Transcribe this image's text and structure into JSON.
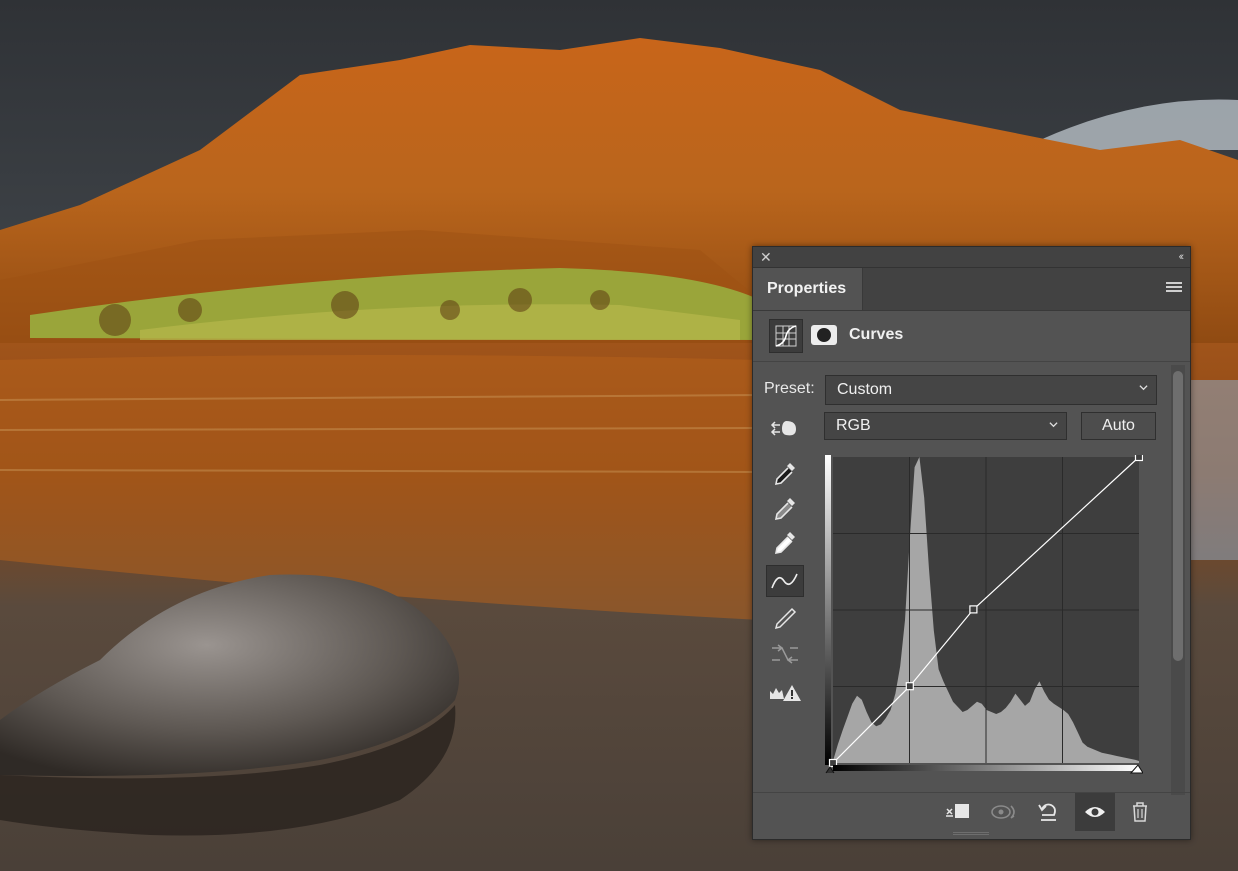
{
  "panel": {
    "tab_label": "Properties",
    "adjustment_title": "Curves",
    "preset": {
      "label": "Preset:",
      "value": "Custom"
    },
    "channel": {
      "value": "RGB"
    },
    "auto_label": "Auto",
    "icons": {
      "close": "close-icon",
      "collapse": "collapse-icon",
      "menu": "panel-menu-icon",
      "adjustment": "curves-adjustment-icon",
      "mask": "layer-mask-icon",
      "target": "targeted-adjustment-icon",
      "black_point": "eyedropper-black-icon",
      "gray_point": "eyedropper-gray-icon",
      "white_point": "eyedropper-white-icon",
      "edit_points": "curve-points-icon",
      "draw": "pencil-icon",
      "smooth": "smooth-curve-icon",
      "clipping": "clipping-warning-icon",
      "clip_to_layer": "clip-to-layer-icon",
      "view_previous": "view-previous-icon",
      "reset": "reset-icon",
      "visibility": "eye-icon",
      "delete": "trash-icon"
    },
    "colors": {
      "panel": "#535353",
      "curve": "#ffffff",
      "histogram": "#a6a6a6"
    }
  },
  "chart_data": {
    "type": "area",
    "xlim": [
      0,
      255
    ],
    "ylim": [
      0,
      255
    ],
    "grid": true,
    "curve_points": [
      [
        0,
        0
      ],
      [
        64,
        64
      ],
      [
        117,
        128
      ],
      [
        255,
        255
      ]
    ],
    "histogram": {
      "x": [
        0,
        4,
        8,
        12,
        16,
        20,
        24,
        28,
        32,
        36,
        40,
        44,
        48,
        52,
        56,
        60,
        64,
        68,
        72,
        76,
        80,
        84,
        88,
        92,
        96,
        100,
        104,
        108,
        112,
        116,
        120,
        124,
        128,
        132,
        136,
        140,
        144,
        148,
        152,
        156,
        160,
        164,
        168,
        172,
        176,
        180,
        184,
        188,
        192,
        196,
        200,
        204,
        208,
        212,
        216,
        220,
        224,
        228,
        232,
        236,
        240,
        244,
        248,
        252,
        255
      ],
      "values": [
        2,
        18,
        32,
        45,
        58,
        66,
        62,
        50,
        40,
        36,
        38,
        44,
        52,
        68,
        95,
        140,
        220,
        290,
        300,
        260,
        190,
        130,
        92,
        80,
        70,
        60,
        55,
        50,
        52,
        56,
        60,
        58,
        52,
        50,
        48,
        50,
        54,
        60,
        68,
        62,
        56,
        60,
        72,
        80,
        70,
        62,
        58,
        55,
        52,
        48,
        40,
        30,
        20,
        16,
        14,
        12,
        10,
        9,
        8,
        7,
        6,
        5,
        4,
        3,
        2
      ]
    }
  }
}
